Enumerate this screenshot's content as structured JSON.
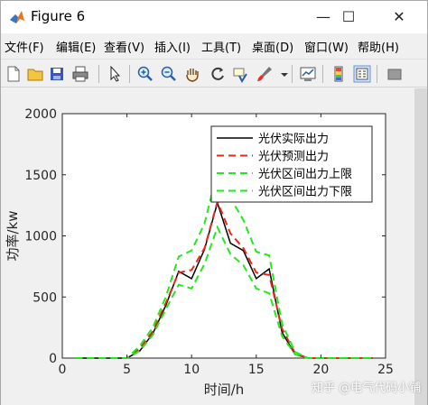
{
  "window": {
    "title": "Figure 6",
    "minimize_glyph": "—",
    "maximize_glyph": "☐",
    "close_glyph": "✕"
  },
  "menu": [
    "文件(F)",
    "编辑(E)",
    "查看(V)",
    "插入(I)",
    "工具(T)",
    "桌面(D)",
    "窗口(W)",
    "帮助(H)"
  ],
  "toolbar_icons": [
    "new-figure-icon",
    "open-file-icon",
    "save-icon",
    "print-icon",
    "select-arrow-icon",
    "zoom-in-icon",
    "zoom-out-icon",
    "pan-hand-icon",
    "rotate-3d-icon",
    "data-cursor-icon",
    "brush-icon",
    "link-plot-icon",
    "colorbar-icon",
    "legend-icon",
    "property-editor-icon"
  ],
  "watermark": "知乎 @电气代码小铺",
  "chart_data": {
    "type": "line",
    "xlabel": "时间/h",
    "ylabel": "功率/kw",
    "xlim": [
      0,
      25
    ],
    "ylim": [
      0,
      2000
    ],
    "xticks": [
      0,
      5,
      10,
      15,
      20,
      25
    ],
    "yticks": [
      0,
      500,
      1000,
      1500,
      2000
    ],
    "grid": false,
    "legend_position": "top-right",
    "x": [
      1,
      2,
      3,
      4,
      5,
      6,
      7,
      8,
      9,
      10,
      11,
      12,
      13,
      14,
      15,
      16,
      17,
      18,
      19,
      20,
      21,
      22,
      23,
      24
    ],
    "series": [
      {
        "name": "光伏实际出力",
        "color": "#000000",
        "dash": "solid",
        "values": [
          0,
          0,
          0,
          0,
          0,
          60,
          200,
          430,
          710,
          650,
          890,
          1270,
          940,
          880,
          650,
          730,
          210,
          30,
          0,
          0,
          0,
          0,
          0,
          0
        ]
      },
      {
        "name": "光伏预测出力",
        "color": "#e8271f",
        "dash": "dashed",
        "values": [
          0,
          0,
          0,
          0,
          0,
          80,
          220,
          450,
          700,
          720,
          900,
          1280,
          1020,
          900,
          700,
          680,
          240,
          40,
          0,
          0,
          0,
          0,
          0,
          0
        ]
      },
      {
        "name": "光伏区间出力上限",
        "color": "#22e81e",
        "dash": "dashed",
        "values": [
          0,
          0,
          0,
          0,
          0,
          100,
          250,
          500,
          830,
          880,
          1100,
          1530,
          1310,
          1130,
          870,
          840,
          280,
          50,
          0,
          0,
          0,
          0,
          0,
          0
        ]
      },
      {
        "name": "光伏区间出力下限",
        "color": "#22e81e",
        "dash": "dashed",
        "values": [
          0,
          0,
          0,
          0,
          0,
          60,
          190,
          400,
          600,
          570,
          770,
          1070,
          850,
          760,
          570,
          530,
          180,
          30,
          0,
          0,
          0,
          0,
          0,
          0
        ]
      }
    ]
  }
}
